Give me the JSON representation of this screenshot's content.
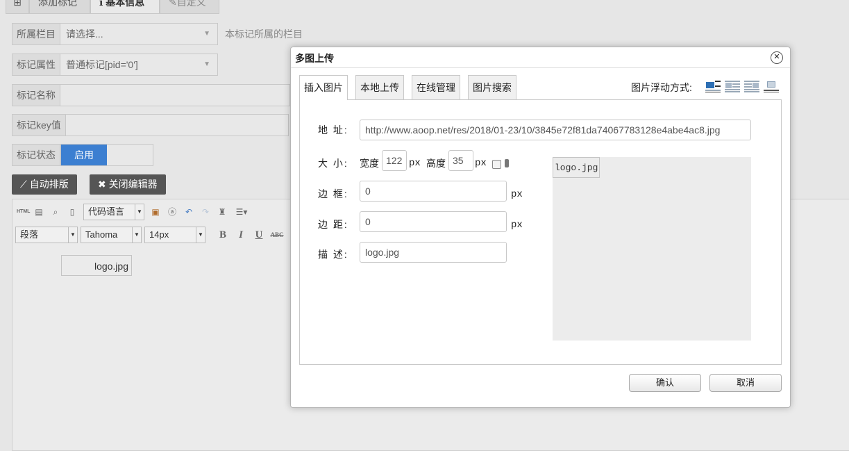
{
  "tabs": {
    "add": "添加标记",
    "base": "基本信息",
    "custom": "自定义"
  },
  "form": {
    "column": {
      "label": "所属栏目",
      "value": "请选择...",
      "help": "本标记所属的栏目"
    },
    "attr": {
      "label": "标记属性",
      "value": "普通标记[pid='0']"
    },
    "name": {
      "label": "标记名称"
    },
    "key": {
      "label": "标记key值"
    },
    "status": {
      "label": "标记状态",
      "on": "启用"
    }
  },
  "buttons": {
    "auto_layout": "自动排版",
    "close_editor": "关闭编辑器"
  },
  "editor": {
    "code_lang": "代码语言",
    "paragraph": "段落",
    "font": "Tahoma",
    "size": "14px",
    "html_label": "HTML",
    "content_image_alt": "logo.jpg"
  },
  "modal": {
    "title": "多图上传",
    "tabs": [
      "插入图片",
      "本地上传",
      "在线管理",
      "图片搜索"
    ],
    "float_label": "图片浮动方式:",
    "address_label": "地 址:",
    "address_value": "http://www.aoop.net/res/2018/01-23/10/3845e72f81da74067783128e4abe4ac8.jpg",
    "size_label": "大 小:",
    "width_label": "宽度",
    "width_value": "122",
    "height_label": "高度",
    "height_value": "35",
    "px": "px",
    "border_label": "边 框:",
    "border_value": "0",
    "margin_label": "边 距:",
    "margin_value": "0",
    "desc_label": "描 述:",
    "desc_value": "logo.jpg",
    "preview_alt": "logo.jpg",
    "confirm": "确认",
    "cancel": "取消"
  },
  "colors": {
    "accent": "#3c7fd1",
    "dark_button": "#555555"
  }
}
